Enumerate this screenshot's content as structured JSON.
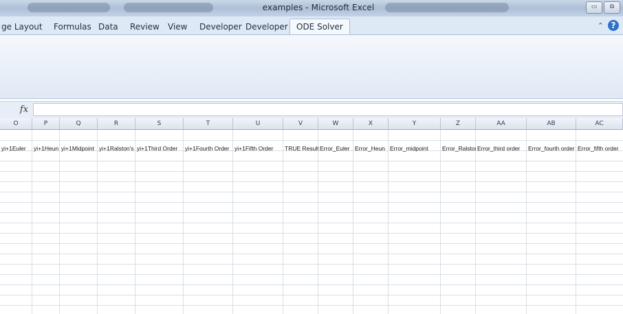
{
  "window": {
    "title": "examples - Microsoft Excel",
    "min_btn": "▭",
    "restore_btn": "⧉"
  },
  "ribbon_tabs": [
    {
      "label": "ge Layout",
      "active": false
    },
    {
      "label": "Formulas",
      "active": false
    },
    {
      "label": "Data",
      "active": false
    },
    {
      "label": "Review",
      "active": false
    },
    {
      "label": "View",
      "active": false
    },
    {
      "label": "Developer",
      "active": false
    },
    {
      "label": "Developer",
      "active": false
    },
    {
      "label": "ODE Solver",
      "active": true
    }
  ],
  "ribbon_icons": {
    "minimize_ribbon": "caret-up-icon",
    "help": "help-icon",
    "help_glyph": "?"
  },
  "formula_bar": {
    "fx_label": "fx",
    "value": ""
  },
  "sheet": {
    "columns": [
      "O",
      "P",
      "Q",
      "R",
      "S",
      "T",
      "U",
      "V",
      "W",
      "X",
      "Y",
      "Z",
      "AA",
      "AB",
      "AC"
    ],
    "header_row": [
      "yi+1Euler",
      "yi+1Heun",
      "yi+1Midpoint",
      "yi+1Ralston's",
      "yi+1Third Order",
      "yi+1Fourth Order",
      "yi+1Fifth Order",
      "TRUE Results",
      "Error_Euler",
      "Error_Heun",
      "Error_midpoint",
      "Error_Ralston'",
      "Error_third order",
      "Error_fourth order",
      "Error_fifth order"
    ]
  },
  "colors": {
    "ribbon_bg": "#dfe9f5",
    "gridline": "#d9dee5",
    "help_blue": "#2f71c9"
  }
}
